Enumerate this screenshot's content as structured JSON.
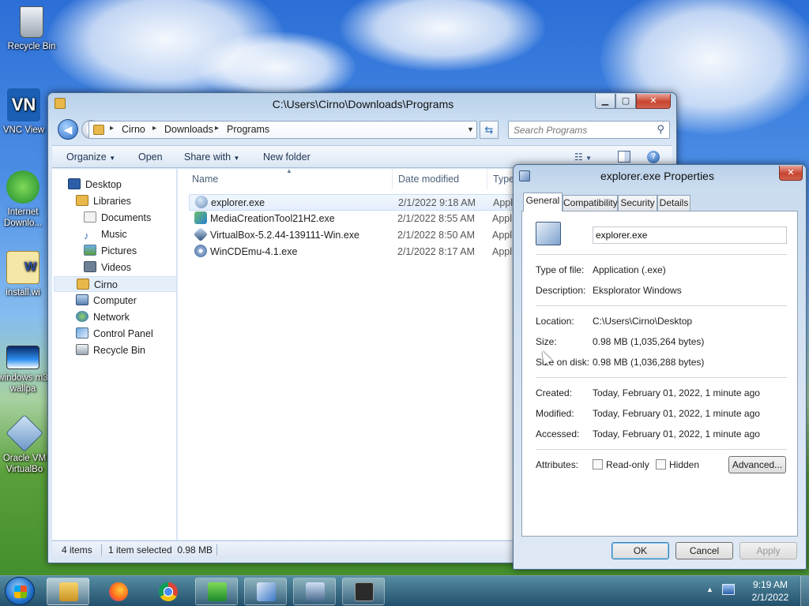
{
  "desktop": {
    "icons": [
      {
        "label": "Recycle Bin",
        "icon": "recycle-bin-icon"
      },
      {
        "label": "VNC View",
        "icon": "vnc-viewer-icon"
      },
      {
        "label": "Internet Downlo...",
        "icon": "internet-download-manager-icon"
      },
      {
        "label": "install.wi",
        "icon": "word-document-icon"
      },
      {
        "label": "windows m3 wallpa",
        "icon": "wallpaper-image-icon"
      },
      {
        "label": "Oracle VM VirtualBo",
        "icon": "virtualbox-icon"
      }
    ]
  },
  "explorer": {
    "title": "C:\\Users\\Cirno\\Downloads\\Programs",
    "breadcrumb": [
      "Cirno",
      "Downloads",
      "Programs"
    ],
    "search_placeholder": "Search Programs",
    "toolbar": {
      "organize": "Organize",
      "open": "Open",
      "share_with": "Share with",
      "new_folder": "New folder"
    },
    "nav": [
      {
        "label": "Desktop",
        "icon": "desktop-icon",
        "level": 0
      },
      {
        "label": "Libraries",
        "icon": "libraries-icon",
        "level": 1
      },
      {
        "label": "Documents",
        "icon": "documents-icon",
        "level": 2
      },
      {
        "label": "Music",
        "icon": "music-icon",
        "level": 2
      },
      {
        "label": "Pictures",
        "icon": "pictures-icon",
        "level": 2
      },
      {
        "label": "Videos",
        "icon": "videos-icon",
        "level": 2
      },
      {
        "label": "Cirno",
        "icon": "user-folder-icon",
        "level": 1,
        "selected": true
      },
      {
        "label": "Computer",
        "icon": "computer-icon",
        "level": 1
      },
      {
        "label": "Network",
        "icon": "network-icon",
        "level": 1
      },
      {
        "label": "Control Panel",
        "icon": "control-panel-icon",
        "level": 1
      },
      {
        "label": "Recycle Bin",
        "icon": "recycle-bin-icon",
        "level": 1
      }
    ],
    "columns": {
      "name": "Name",
      "date": "Date modified",
      "type": "Type"
    },
    "files": [
      {
        "name": "explorer.exe",
        "date": "2/1/2022 9:18 AM",
        "type": "Appl",
        "icon": "explorer-exe-icon",
        "selected": true
      },
      {
        "name": "MediaCreationTool21H2.exe",
        "date": "2/1/2022 8:55 AM",
        "type": "Appl",
        "icon": "media-creation-tool-icon"
      },
      {
        "name": "VirtualBox-5.2.44-139111-Win.exe",
        "date": "2/1/2022 8:50 AM",
        "type": "Appl",
        "icon": "virtualbox-installer-icon"
      },
      {
        "name": "WinCDEmu-4.1.exe",
        "date": "2/1/2022 8:17 AM",
        "type": "Appl",
        "icon": "wincdemu-icon"
      }
    ],
    "status": {
      "count": "4 items",
      "selection": "1 item selected  0.98 MB"
    }
  },
  "properties": {
    "title": "explorer.exe Properties",
    "tabs": [
      "General",
      "Compatibility",
      "Security",
      "Details"
    ],
    "active_tab": "General",
    "filename": "explorer.exe",
    "fields": {
      "type_label": "Type of file:",
      "type_value": "Application (.exe)",
      "desc_label": "Description:",
      "desc_value": "Eksplorator Windows",
      "location_label": "Location:",
      "location_value": "C:\\Users\\Cirno\\Desktop",
      "size_label": "Size:",
      "size_value": "0.98 MB (1,035,264 bytes)",
      "disk_label": "Size on disk:",
      "disk_value": "0.98 MB (1,036,288 bytes)",
      "created_label": "Created:",
      "created_value": "Today, February 01, 2022, 1 minute ago",
      "modified_label": "Modified:",
      "modified_value": "Today, February 01, 2022, 1 minute ago",
      "accessed_label": "Accessed:",
      "accessed_value": "Today, February 01, 2022, 1 minute ago",
      "attributes_label": "Attributes:"
    },
    "attributes": {
      "readonly": "Read-only",
      "hidden": "Hidden",
      "advanced": "Advanced..."
    },
    "buttons": {
      "ok": "OK",
      "cancel": "Cancel",
      "apply": "Apply"
    }
  },
  "taskbar": {
    "time": "9:19 AM",
    "date": "2/1/2022",
    "items": [
      "explorer-icon",
      "firefox-icon",
      "chrome-icon",
      "downloads-icon",
      "control-panel-icon",
      "remote-desktop-icon",
      "vm-icon"
    ]
  }
}
